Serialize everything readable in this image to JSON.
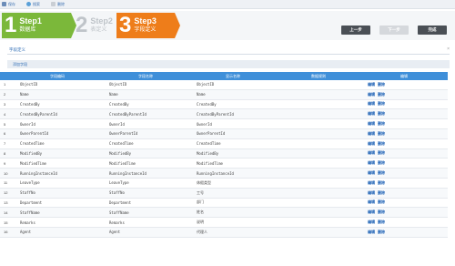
{
  "topbar": {
    "items": [
      {
        "label": "保存",
        "icon": "save-icon"
      },
      {
        "label": "搜索",
        "icon": "search-icon"
      },
      {
        "label": "删除",
        "icon": "delete-icon"
      }
    ]
  },
  "steps": [
    {
      "num": "1",
      "title": "Step1",
      "subtitle": "数据库",
      "state": "done",
      "color": "#7bb83a"
    },
    {
      "num": "2",
      "title": "Step2",
      "subtitle": "表定义",
      "state": "inactive",
      "color": "#bfc4c9"
    },
    {
      "num": "3",
      "title": "Step3",
      "subtitle": "字段定义",
      "state": "active",
      "color": "#ee7d1a"
    }
  ],
  "buttons": {
    "prev": "上一步",
    "next": "下一步",
    "done": "完成"
  },
  "section": {
    "title": "字段定义",
    "close": "×"
  },
  "toolbar": {
    "add_label": "添加字段"
  },
  "table": {
    "columns": [
      "",
      "字段编码",
      "字段名称",
      "显示名称",
      "数据规则",
      "编辑"
    ],
    "actions": {
      "edit": "编辑",
      "delete": "删除"
    },
    "rows": [
      {
        "idx": "1",
        "code": "ObjectID",
        "name": "ObjectID",
        "display": "ObjectID",
        "rule": ""
      },
      {
        "idx": "2",
        "code": "Name",
        "name": "Name",
        "display": "Name",
        "rule": ""
      },
      {
        "idx": "3",
        "code": "CreatedBy",
        "name": "CreatedBy",
        "display": "CreatedBy",
        "rule": ""
      },
      {
        "idx": "4",
        "code": "CreatedByParentId",
        "name": "CreatedByParentId",
        "display": "CreatedByParentId",
        "rule": ""
      },
      {
        "idx": "5",
        "code": "OwnerId",
        "name": "OwnerId",
        "display": "OwnerId",
        "rule": ""
      },
      {
        "idx": "6",
        "code": "OwnerParentId",
        "name": "OwnerParentId",
        "display": "OwnerParentId",
        "rule": ""
      },
      {
        "idx": "7",
        "code": "CreatedTime",
        "name": "CreatedTime",
        "display": "CreatedTime",
        "rule": ""
      },
      {
        "idx": "8",
        "code": "ModifiedBy",
        "name": "ModifiedBy",
        "display": "ModifiedBy",
        "rule": ""
      },
      {
        "idx": "9",
        "code": "ModifiedTime",
        "name": "ModifiedTime",
        "display": "ModifiedTime",
        "rule": ""
      },
      {
        "idx": "10",
        "code": "RunningInstanceId",
        "name": "RunningInstanceId",
        "display": "RunningInstanceId",
        "rule": ""
      },
      {
        "idx": "11",
        "code": "LeaveType",
        "name": "LeaveType",
        "display": "休假类型",
        "rule": ""
      },
      {
        "idx": "12",
        "code": "StaffNo",
        "name": "StaffNo",
        "display": "工号",
        "rule": ""
      },
      {
        "idx": "13",
        "code": "Department",
        "name": "Department",
        "display": "部门",
        "rule": ""
      },
      {
        "idx": "14",
        "code": "StaffName",
        "name": "StaffName",
        "display": "姓名",
        "rule": ""
      },
      {
        "idx": "15",
        "code": "Remarks",
        "name": "Remarks",
        "display": "说明",
        "rule": ""
      },
      {
        "idx": "16",
        "code": "Agent",
        "name": "Agent",
        "display": "代理人",
        "rule": ""
      }
    ]
  }
}
